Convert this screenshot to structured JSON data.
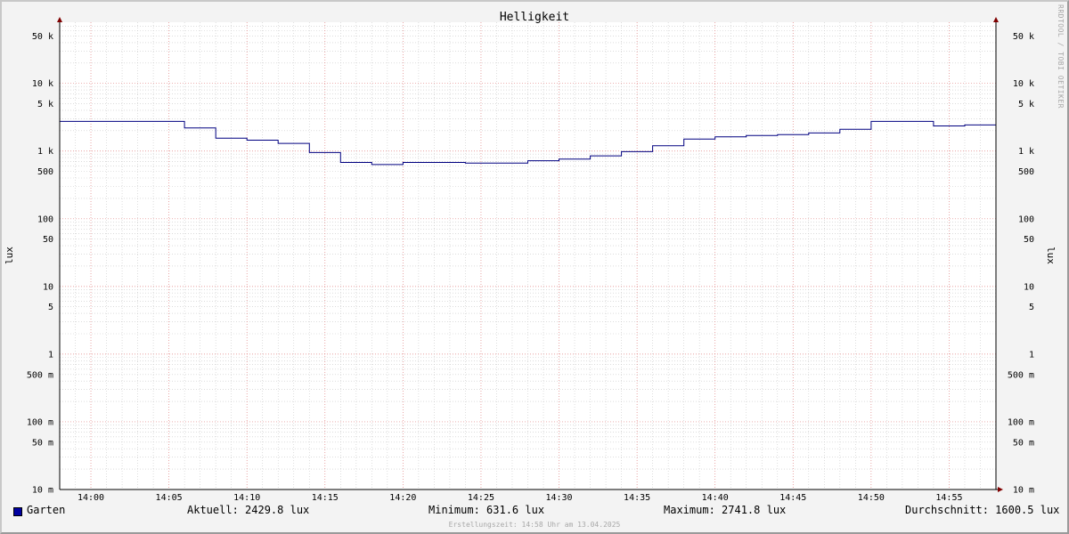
{
  "chart_data": {
    "type": "line",
    "title": "Helligkeit",
    "ylabel_left": "lux",
    "ylabel_right": "lux",
    "y_scale": "log",
    "ylim": [
      0.01,
      80000
    ],
    "xlim": [
      "13:58",
      "14:58"
    ],
    "x_ticks": [
      "14:00",
      "14:05",
      "14:10",
      "14:15",
      "14:20",
      "14:25",
      "14:30",
      "14:35",
      "14:40",
      "14:45",
      "14:50",
      "14:55"
    ],
    "y_ticks": [
      {
        "value": 0.01,
        "label": "10 m"
      },
      {
        "value": 0.05,
        "label": "50 m"
      },
      {
        "value": 0.1,
        "label": "100 m"
      },
      {
        "value": 0.5,
        "label": "500 m"
      },
      {
        "value": 1,
        "label": "1"
      },
      {
        "value": 5,
        "label": "5"
      },
      {
        "value": 10,
        "label": "10"
      },
      {
        "value": 50,
        "label": "50"
      },
      {
        "value": 100,
        "label": "100"
      },
      {
        "value": 500,
        "label": "500"
      },
      {
        "value": 1000,
        "label": "1 k"
      },
      {
        "value": 5000,
        "label": "5 k"
      },
      {
        "value": 10000,
        "label": "10 k"
      },
      {
        "value": 50000,
        "label": "50 k"
      }
    ],
    "grid": true,
    "series": [
      {
        "name": "Garten",
        "color": "#000080",
        "step": true,
        "points": [
          {
            "t": "13:58",
            "v": 2740
          },
          {
            "t": "14:06",
            "v": 2200
          },
          {
            "t": "14:08",
            "v": 1550
          },
          {
            "t": "14:10",
            "v": 1450
          },
          {
            "t": "14:12",
            "v": 1300
          },
          {
            "t": "14:14",
            "v": 950
          },
          {
            "t": "14:16",
            "v": 680
          },
          {
            "t": "14:18",
            "v": 632
          },
          {
            "t": "14:20",
            "v": 680
          },
          {
            "t": "14:24",
            "v": 665
          },
          {
            "t": "14:28",
            "v": 720
          },
          {
            "t": "14:30",
            "v": 760
          },
          {
            "t": "14:32",
            "v": 850
          },
          {
            "t": "14:34",
            "v": 980
          },
          {
            "t": "14:36",
            "v": 1200
          },
          {
            "t": "14:38",
            "v": 1500
          },
          {
            "t": "14:40",
            "v": 1620
          },
          {
            "t": "14:42",
            "v": 1700
          },
          {
            "t": "14:44",
            "v": 1750
          },
          {
            "t": "14:46",
            "v": 1850
          },
          {
            "t": "14:48",
            "v": 2100
          },
          {
            "t": "14:50",
            "v": 2741.8
          },
          {
            "t": "14:54",
            "v": 2350
          },
          {
            "t": "14:56",
            "v": 2429.8
          },
          {
            "t": "14:58",
            "v": 2429.8
          }
        ]
      }
    ]
  },
  "legend": {
    "series_name": "Garten",
    "current": "Aktuell: 2429.8 lux",
    "minimum": "Minimum: 631.6 lux",
    "maximum": "Maximum: 2741.8 lux",
    "average": "Durchschnitt: 1600.5 lux"
  },
  "watermark": "RRDTOOL / TOBI OETIKER",
  "footer": "Erstellungszeit: 14:58 Uhr am 13.04.2025",
  "colors": {
    "line": "#000080",
    "swatch": "#0000a0",
    "major_grid": "#e08080",
    "minor_grid": "#c8c8c8",
    "arrow": "#800000"
  }
}
